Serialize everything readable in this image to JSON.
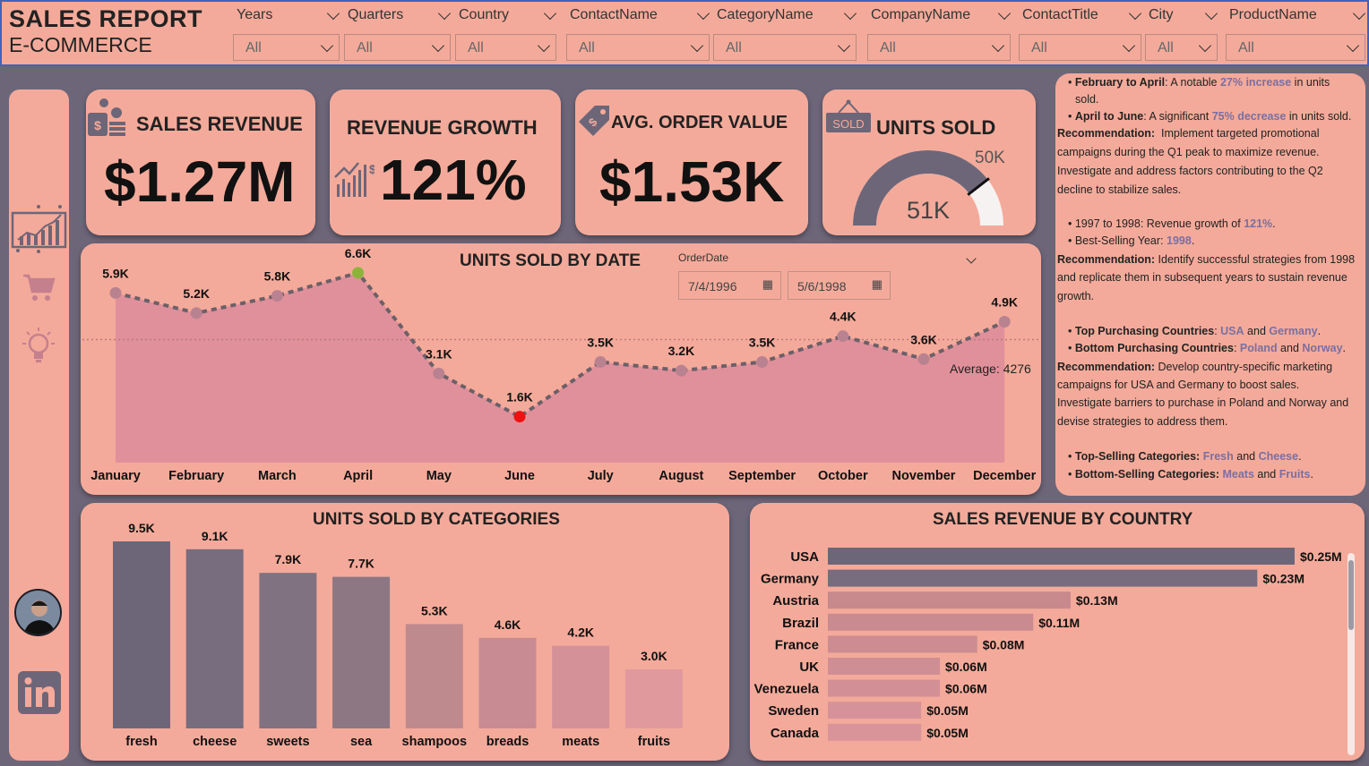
{
  "header": {
    "title_line1": "SALES REPORT",
    "title_line2": "E-COMMERCE",
    "filters": [
      {
        "label": "Years",
        "value": "All"
      },
      {
        "label": "Quarters",
        "value": "All"
      },
      {
        "label": "Country",
        "value": "All"
      },
      {
        "label": "ContactName",
        "value": "All"
      },
      {
        "label": "CategoryName",
        "value": "All"
      },
      {
        "label": "CompanyName",
        "value": "All"
      },
      {
        "label": "ContactTitle",
        "value": "All"
      },
      {
        "label": "City",
        "value": "All"
      },
      {
        "label": "ProductName",
        "value": "All"
      }
    ]
  },
  "sidebar": {
    "icons": [
      "dashboard-chart-icon",
      "cart-icon",
      "lightbulb-icon",
      "avatar",
      "linkedin-icon"
    ]
  },
  "kpis": {
    "sales_revenue": {
      "title": "SALES REVENUE",
      "value": "$1.27M"
    },
    "revenue_growth": {
      "title": "REVENUE GROWTH",
      "value": "121%"
    },
    "avg_order_value": {
      "title": "AVG. ORDER VALUE",
      "value": "$1.53K"
    },
    "units_sold": {
      "title": "UNITS SOLD",
      "value": "51K",
      "max_label": "50K",
      "gauge_fraction": 0.79
    }
  },
  "units_by_date": {
    "title": "UNITS SOLD BY DATE",
    "order_date_label": "OrderDate",
    "date_from": "7/4/1996",
    "date_to": "5/6/1998",
    "average_label": "Average: 4276"
  },
  "chart_data": [
    {
      "type": "line",
      "title": "UNITS SOLD BY DATE",
      "categories": [
        "January",
        "February",
        "March",
        "April",
        "May",
        "June",
        "July",
        "August",
        "September",
        "October",
        "November",
        "December"
      ],
      "values": [
        5900,
        5200,
        5800,
        6600,
        3100,
        1600,
        3500,
        3200,
        3500,
        4400,
        3600,
        4900
      ],
      "data_labels": [
        "5.9K",
        "5.2K",
        "5.8K",
        "6.6K",
        "3.1K",
        "1.6K",
        "3.5K",
        "3.2K",
        "3.5K",
        "4.4K",
        "3.6K",
        "4.9K"
      ],
      "average": 4276,
      "ylim": [
        0,
        7000
      ],
      "highlight_max_color": "#8db43a",
      "highlight_min_color": "#ee1111"
    },
    {
      "type": "bar",
      "title": "UNITS SOLD BY CATEGORIES",
      "categories": [
        "fresh",
        "cheese",
        "sweets",
        "sea",
        "shampoos",
        "breads",
        "meats",
        "fruits"
      ],
      "values": [
        9500,
        9100,
        7900,
        7700,
        5300,
        4600,
        4200,
        3000
      ],
      "data_labels": [
        "9.5K",
        "9.1K",
        "7.9K",
        "7.7K",
        "5.3K",
        "4.6K",
        "4.2K",
        "3.0K"
      ],
      "colors": [
        "#6d6679",
        "#776d7f",
        "#807281",
        "#8c7783",
        "#bf8a8e",
        "#c98b93",
        "#d49197",
        "#e09a9e"
      ],
      "ylim": [
        0,
        10000
      ]
    },
    {
      "type": "bar",
      "orientation": "horizontal",
      "title": "SALES REVENUE BY COUNTRY",
      "categories": [
        "USA",
        "Germany",
        "Austria",
        "Brazil",
        "France",
        "UK",
        "Venezuela",
        "Sweden",
        "Canada"
      ],
      "values": [
        0.25,
        0.23,
        0.13,
        0.11,
        0.08,
        0.06,
        0.06,
        0.05,
        0.05
      ],
      "data_labels": [
        "$0.25M",
        "$0.23M",
        "$0.13M",
        "$0.11M",
        "$0.08M",
        "$0.06M",
        "$0.06M",
        "$0.05M",
        "$0.05M"
      ],
      "colors": [
        "#6d6679",
        "#776d7f",
        "#c7898c",
        "#c98b8f",
        "#cc8c92",
        "#cf8e94",
        "#d29096",
        "#d59298",
        "#d89499"
      ],
      "xlim": [
        0,
        0.25
      ]
    }
  ],
  "units_by_categories": {
    "title": "UNITS SOLD BY CATEGORIES"
  },
  "sales_by_country": {
    "title": "SALES REVENUE BY COUNTRY"
  },
  "colors": {
    "background": "#6d6679",
    "panel": "#f4aa9a",
    "area_fill": "#e0909a",
    "line": "#6b6068",
    "accent_text": "#7a6fa0"
  }
}
